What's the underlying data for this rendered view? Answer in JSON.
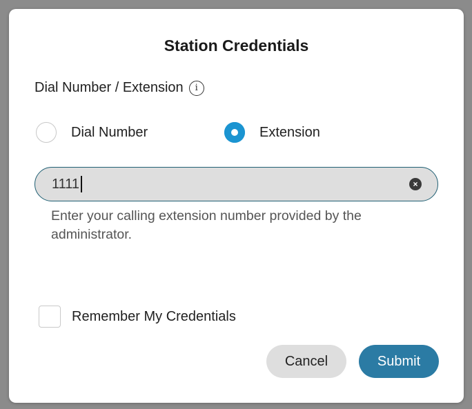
{
  "dialog": {
    "title": "Station Credentials",
    "section_label": "Dial Number / Extension",
    "info_icon_glyph": "i",
    "radio_options": [
      {
        "label": "Dial Number",
        "checked": false
      },
      {
        "label": "Extension",
        "checked": true
      }
    ],
    "input": {
      "value": "1111",
      "clear_icon": "×"
    },
    "helper_text": "Enter your calling extension number provided by the administrator.",
    "remember_label": "Remember My Credentials",
    "remember_checked": false,
    "cancel_label": "Cancel",
    "submit_label": "Submit"
  },
  "colors": {
    "accent": "#1b94d1",
    "submit": "#2b7ba4",
    "input_border": "#1f5f73",
    "input_bg": "#dedede"
  }
}
